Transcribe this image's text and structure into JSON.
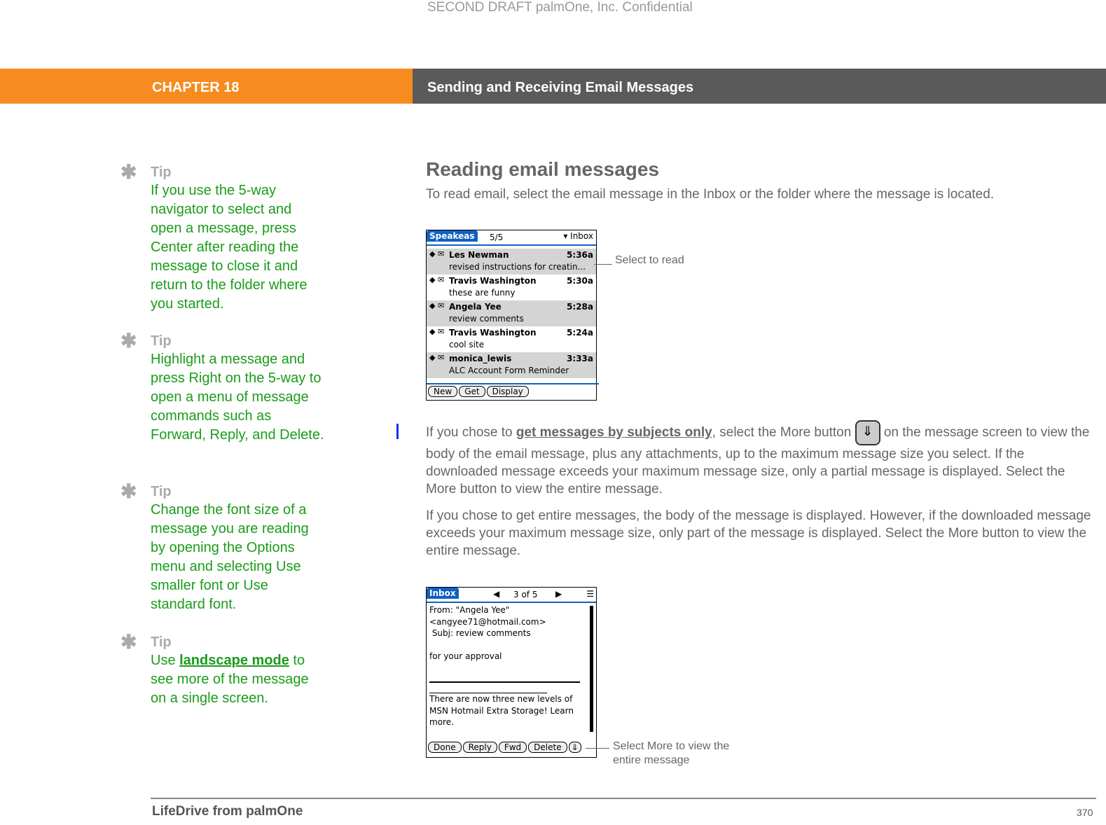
{
  "watermark": "SECOND DRAFT palmOne, Inc.  Confidential",
  "header": {
    "chapter": "CHAPTER 18",
    "title": "Sending and Receiving Email Messages"
  },
  "tips": [
    {
      "label": "Tip",
      "text": "If you use the 5-way navigator to select and open a message, press Center after reading the message to close it and return to the folder where you started."
    },
    {
      "label": "Tip",
      "text": "Highlight a message and press Right on the 5-way to open a menu of message commands such as Forward, Reply, and Delete."
    },
    {
      "label": "Tip",
      "text": "Change the font size of a message you are reading by opening the Options menu and selecting Use smaller font or Use standard font."
    },
    {
      "label": "Tip",
      "pre": "Use ",
      "link": "landscape mode",
      "post": " to see more of the message on a single screen."
    }
  ],
  "main": {
    "heading": "Reading email messages",
    "intro": "To read email, select the email message in the Inbox or the folder where the message is located.",
    "para1_pre": "If you chose to ",
    "para1_link": "get messages by subjects only",
    "para1_mid": ", select the More button",
    "para1_post": " on the message screen to view the body of the email message, plus any attachments, up to the maximum message size you select. If the downloaded message exceeds your maximum message size, only a partial message is displayed. Select the More button to view the entire message.",
    "para2": "If you chose to get entire messages, the body of the message is displayed. However, if the downloaded message exceeds your maximum message size, only part of the message is displayed. Select the More button to view the entire message."
  },
  "screen1": {
    "tab": "Speakeas",
    "count": "5/5",
    "folder": "Inbox",
    "messages": [
      {
        "from": "Les Newman",
        "time": "5:36a",
        "subject": "revised instructions for creatin..."
      },
      {
        "from": "Travis Washington",
        "time": "5:30a",
        "subject": "these are funny"
      },
      {
        "from": "Angela Yee",
        "time": "5:28a",
        "subject": "review comments"
      },
      {
        "from": "Travis Washington",
        "time": "5:24a",
        "subject": "cool site"
      },
      {
        "from": "monica_lewis",
        "time": "3:33a",
        "subject": "ALC Account Form Reminder"
      }
    ],
    "buttons": [
      "New",
      "Get",
      "Display"
    ],
    "callout": "Select to read"
  },
  "screen2": {
    "tab": "Inbox",
    "position": "3 of 5",
    "lines": [
      "From: \"Angela Yee\"",
      "<angyee71@hotmail.com>",
      " Subj: review comments",
      "",
      "for your approval"
    ],
    "footer_text": "There are now three new levels of MSN Hotmail Extra Storage!  Learn more.",
    "buttons": [
      "Done",
      "Reply",
      "Fwd",
      "Delete"
    ],
    "callout": "Select More to view the entire message"
  },
  "footer": {
    "book": "LifeDrive from palmOne",
    "page": "370"
  }
}
